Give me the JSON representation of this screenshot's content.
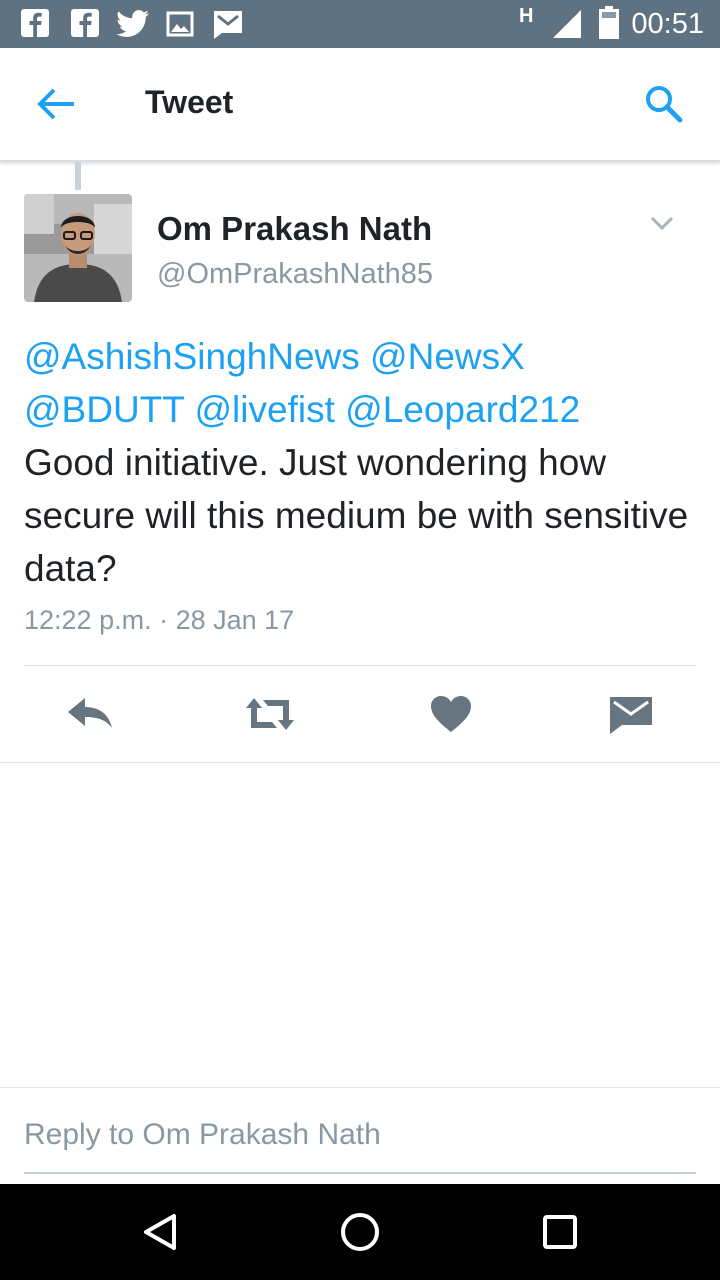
{
  "status_bar": {
    "time": "00:51",
    "network_type": "H",
    "notification_icons": [
      "facebook-icon",
      "facebook-icon",
      "twitter-icon",
      "image-icon",
      "mail-icon"
    ]
  },
  "app_bar": {
    "title": "Tweet"
  },
  "tweet": {
    "author_name": "Om Prakash Nath",
    "author_handle": "@OmPrakashNath85",
    "mentions": [
      "@AshishSinghNews",
      "@NewsX",
      "@BDUTT",
      "@livefist",
      "@Leopard212"
    ],
    "text": "Good initiative. Just wondering how secure will this medium be with sensitive data?",
    "timestamp": "12:22 p.m. · 28 Jan 17"
  },
  "actions": [
    "reply-icon",
    "retweet-icon",
    "heart-icon",
    "direct-message-icon"
  ],
  "reply_bar": {
    "placeholder": "Reply to Om Prakash Nath"
  },
  "colors": {
    "status_bar": "#5f7282",
    "accent": "#1da1f2",
    "action_icons": "#66757f",
    "secondary_text": "#8a98a4"
  }
}
